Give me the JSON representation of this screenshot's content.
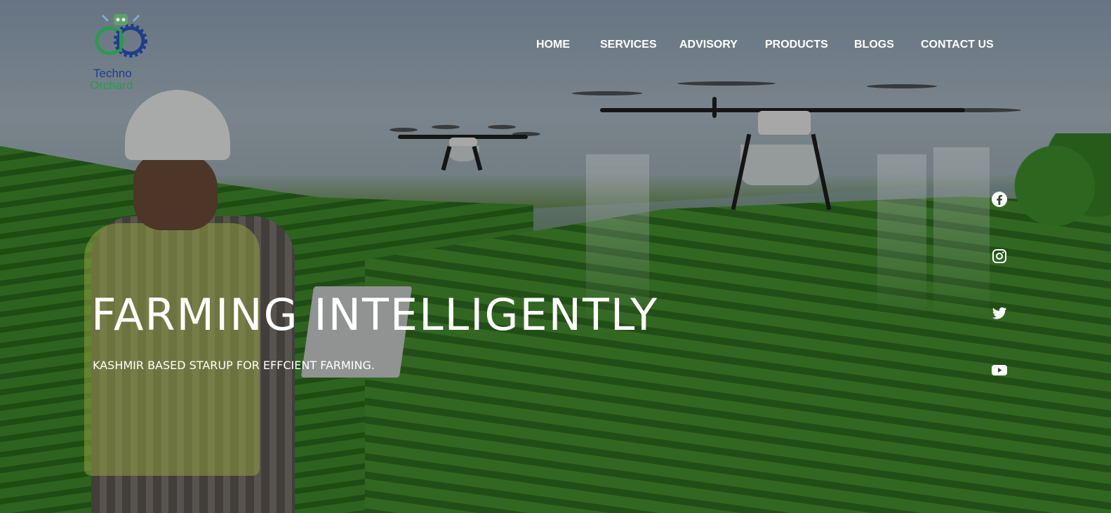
{
  "brand": {
    "name_line1": "Techno",
    "name_line2": "Orchard",
    "color_primary": "#1f3d8a",
    "color_secondary": "#2a9a4e"
  },
  "nav": {
    "items": [
      {
        "label": "HOME"
      },
      {
        "label": "SERVICES"
      },
      {
        "label": "ADVISORY"
      },
      {
        "label": "PRODUCTS"
      },
      {
        "label": "BLOGS"
      },
      {
        "label": "CONTACT US"
      }
    ]
  },
  "hero": {
    "headline": "FARMING INTELLIGENTLY",
    "subline": "KASHMIR BASED STARUP FOR EFFCIENT FARMING."
  },
  "social": {
    "icons": [
      "facebook-icon",
      "instagram-icon",
      "twitter-icon",
      "youtube-icon"
    ]
  }
}
